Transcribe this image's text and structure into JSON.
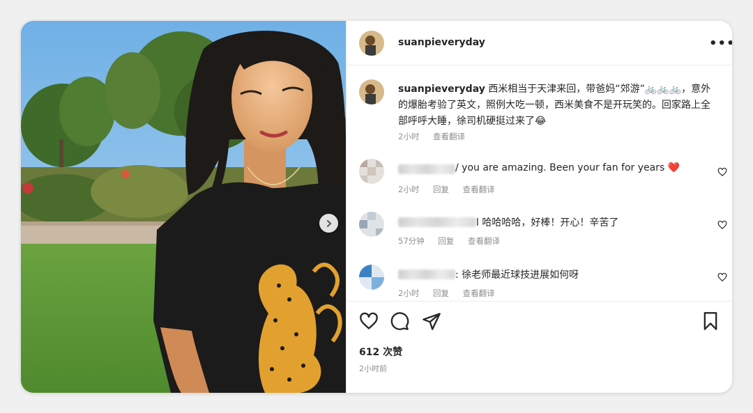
{
  "post": {
    "username": "suanpieveryday",
    "more_glyph": "•••"
  },
  "caption": {
    "username": "suanpieveryday",
    "text": "西米相当于天津来回，带爸妈“郊游”",
    "emoji": "🚲🚲🚲",
    "text2": "，意外的爆胎考验了英文，照例大吃一顿，西米美食不是开玩笑的。回家路上全部呼呼大睡，徐司机硬挺过来了",
    "emoji2": "😂",
    "time": "2小时",
    "translate": "查看翻译"
  },
  "comments": [
    {
      "text": "/ you are amazing. Been your fan for years",
      "emoji": "❤️",
      "time": "2小时",
      "reply": "回复",
      "translate": "查看翻译"
    },
    {
      "text": "l 哈哈哈哈，好棒！开心！辛苦了",
      "time": "57分钟",
      "reply": "回复",
      "translate": "查看翻译"
    },
    {
      "text": ": 徐老师最近球技进展如何呀",
      "time": "2小时",
      "reply": "回复",
      "translate": "查看翻译"
    }
  ],
  "footer": {
    "likes": "612 次赞",
    "posted": "2小时前"
  },
  "colors": {
    "text": "#262626",
    "muted": "#8e8e8e",
    "heart": "#ed4956",
    "sky": "#7fb7e6",
    "lawn": "#5f9a3a"
  },
  "icons": [
    "chevron-right-icon",
    "more-icon",
    "heart-icon",
    "comment-icon",
    "share-icon",
    "bookmark-icon"
  ]
}
